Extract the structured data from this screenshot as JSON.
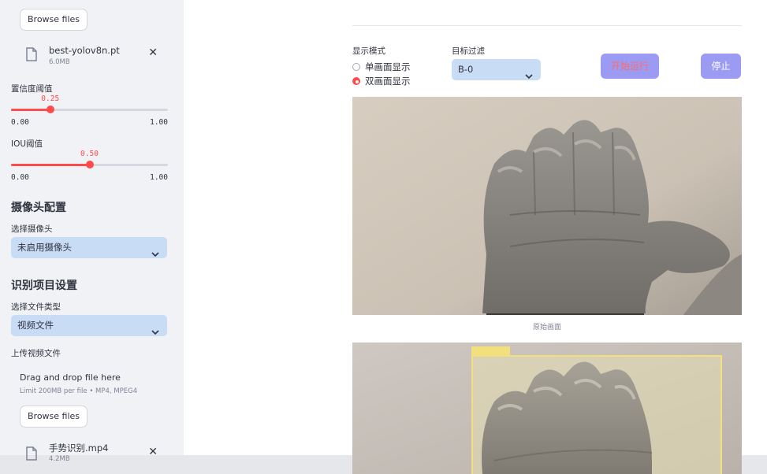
{
  "colors": {
    "accent": "#ff4b4b",
    "select_bg": "#c8dcf6",
    "button_bg": "#9b9bf4",
    "detection_box": "#f1e07c"
  },
  "sidebar": {
    "model_upload": {
      "browse_label": "Browse files",
      "file_name": "best-yolov8n.pt",
      "file_size": "6.0MB"
    },
    "confidence": {
      "label": "置信度阈值",
      "value": 0.25,
      "value_text": "0.25",
      "min_text": "0.00",
      "max_text": "1.00"
    },
    "iou": {
      "label": "IOU阈值",
      "value": 0.5,
      "value_text": "0.50",
      "min_text": "0.00",
      "max_text": "1.00"
    },
    "camera_section": {
      "title": "摄像头配置",
      "select_label": "选择摄像头",
      "select_value": "未启用摄像头"
    },
    "project_section": {
      "title": "识别项目设置",
      "type_label": "选择文件类型",
      "type_value": "视频文件",
      "upload_label": "上传视频文件",
      "drop_title": "Drag and drop file here",
      "drop_limit": "Limit 200MB per file • MP4, MPEG4",
      "browse_label": "Browse files",
      "file_name": "手势识别.mp4",
      "file_size": "4.2MB"
    }
  },
  "main": {
    "display_mode": {
      "label": "显示模式",
      "options": [
        "单画面显示",
        "双画面显示"
      ],
      "selected": "双画面显示"
    },
    "target_filter": {
      "label": "目标过滤",
      "value": "B-0"
    },
    "start_label": "开始运行",
    "stop_label": "停止",
    "original_caption": "原始画面"
  }
}
